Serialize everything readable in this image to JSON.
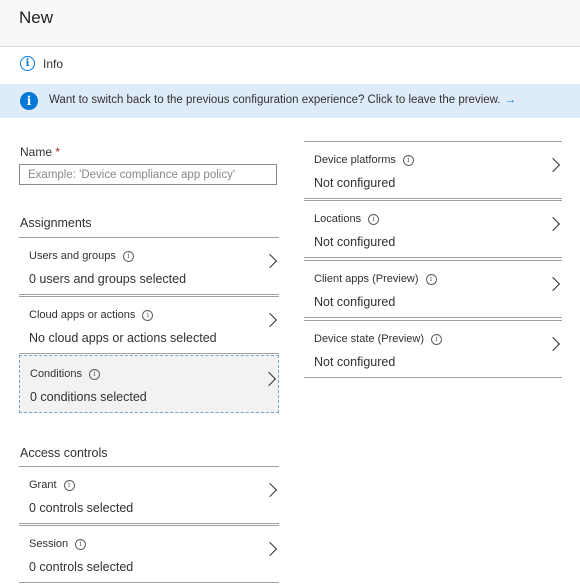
{
  "header": {
    "title": "New"
  },
  "info": {
    "label": "Info",
    "icon": "info-icon"
  },
  "banner": {
    "text": "Want to switch back to the previous configuration experience? Click to leave the preview.",
    "arrow": "→",
    "icon": "info-filled-icon",
    "color": "#deecf9",
    "accent": "#0078d4"
  },
  "name": {
    "label": "Name",
    "required_mark": "*",
    "placeholder": "Example: 'Device compliance app policy'"
  },
  "assignments": {
    "heading": "Assignments",
    "items": [
      {
        "title": "Users and groups",
        "value": "0 users and groups selected"
      },
      {
        "title": "Cloud apps or actions",
        "value": "No cloud apps or actions selected"
      },
      {
        "title": "Conditions",
        "value": "0 conditions selected"
      }
    ]
  },
  "access_controls": {
    "heading": "Access controls",
    "items": [
      {
        "title": "Grant",
        "value": "0 controls selected"
      },
      {
        "title": "Session",
        "value": "0 controls selected"
      }
    ]
  },
  "conditions_panel": {
    "items": [
      {
        "title": "Device platforms",
        "value": "Not configured"
      },
      {
        "title": "Locations",
        "value": "Not configured"
      },
      {
        "title": "Client apps (Preview)",
        "value": "Not configured"
      },
      {
        "title": "Device state (Preview)",
        "value": "Not configured"
      }
    ]
  }
}
